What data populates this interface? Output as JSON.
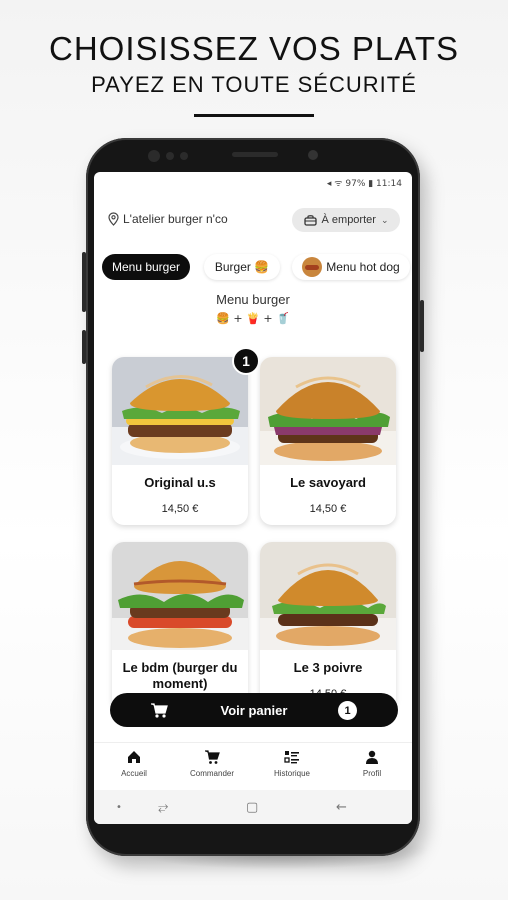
{
  "promo": {
    "title": "CHOISISSEZ VOS PLATS",
    "subtitle": "PAYEZ EN TOUTE SÉCURITÉ"
  },
  "status_bar": {
    "text": "◂ ᯤ 97% ▮ 11:14"
  },
  "header": {
    "location": "L'atelier burger n'co",
    "mode": "À emporter"
  },
  "categories": [
    {
      "label": "Menu burger",
      "active": true
    },
    {
      "label": "Burger 🍔",
      "active": false
    },
    {
      "label": "Menu hot dog",
      "active": false
    }
  ],
  "section": {
    "title": "Menu burger",
    "icons": "🍔 + 🍟 + 🥤"
  },
  "products": [
    {
      "name": "Original u.s",
      "price": "14,50 €",
      "quantity": "1"
    },
    {
      "name": "Le savoyard",
      "price": "14,50 €"
    },
    {
      "name": "Le bdm (burger du moment)",
      "price": ""
    },
    {
      "name": "Le 3 poivre",
      "price": "14,50 €"
    }
  ],
  "cart": {
    "label": "Voir panier",
    "count": "1"
  },
  "bottom_nav": [
    {
      "label": "Accueil",
      "icon": "home-icon"
    },
    {
      "label": "Commander",
      "icon": "cart-icon"
    },
    {
      "label": "Historique",
      "icon": "history-icon"
    },
    {
      "label": "Profil",
      "icon": "person-icon"
    }
  ],
  "android_nav": {
    "dot": "•",
    "recents": "⥂",
    "home": "▢",
    "back": "←"
  },
  "colors": {
    "primary": "#0d0d0d",
    "accent_bun": "#d9962f",
    "background": "#ffffff"
  }
}
